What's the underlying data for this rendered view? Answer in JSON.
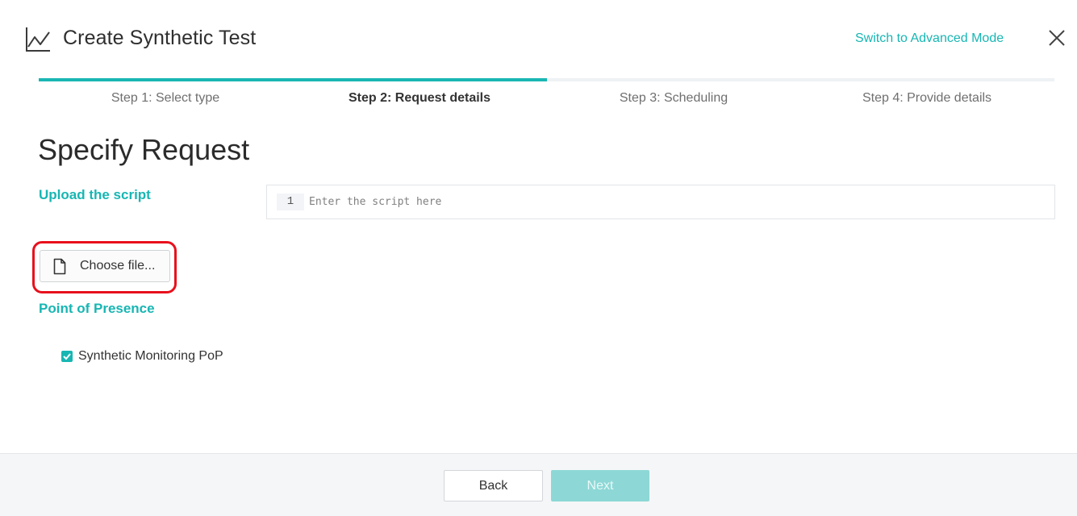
{
  "header": {
    "title": "Create Synthetic Test",
    "advanced_link": "Switch to Advanced Mode",
    "close_icon": "close-icon",
    "title_icon": "line-chart-icon"
  },
  "progress": {
    "current_step": 2,
    "total_steps": 4,
    "fill_fraction": 0.5,
    "accent": "#19b6b3"
  },
  "steps": [
    {
      "label": "Step 1: Select type",
      "active": false
    },
    {
      "label": "Step 2: Request details",
      "active": true
    },
    {
      "label": "Step 3: Scheduling",
      "active": false
    },
    {
      "label": "Step 4: Provide details",
      "active": false
    }
  ],
  "main": {
    "page_title": "Specify Request",
    "upload_label": "Upload the script",
    "editor": {
      "line_number": "1",
      "placeholder": "Enter the script here",
      "value": ""
    },
    "choose_file_label": "Choose file...",
    "choose_file_icon": "document-icon",
    "pop_label": "Point of Presence",
    "pop_option": {
      "label": "Synthetic Monitoring PoP",
      "checked": true
    }
  },
  "footer": {
    "back_label": "Back",
    "next_label": "Next",
    "next_disabled_color": "#8dd8d6"
  },
  "colors": {
    "accent": "#17b6b3",
    "highlight": "#e8101c"
  }
}
